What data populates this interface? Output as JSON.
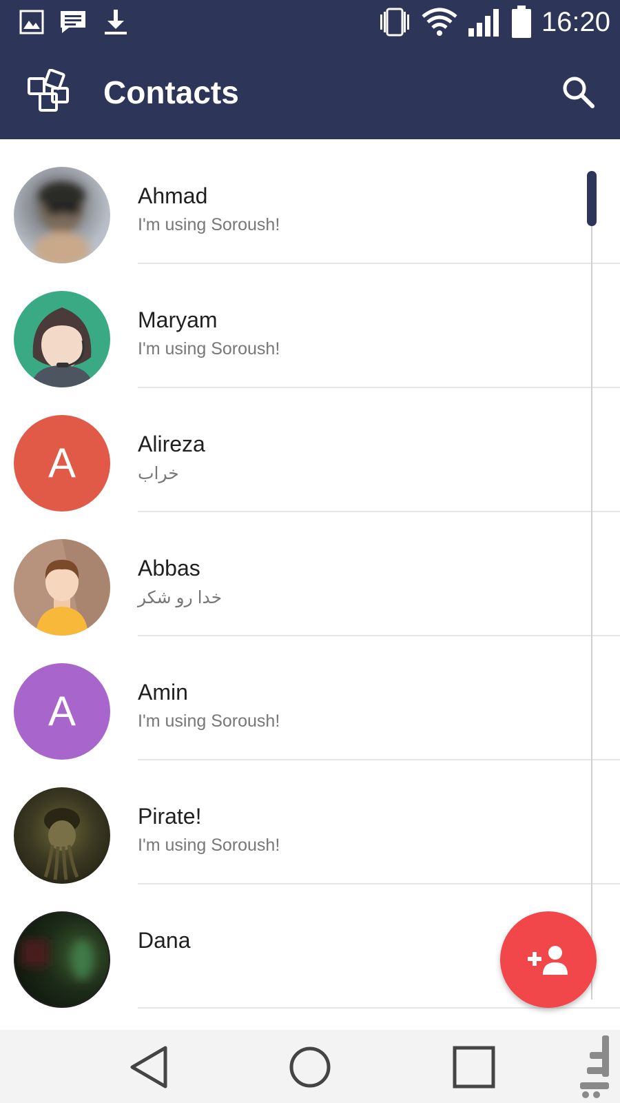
{
  "status_bar": {
    "time": "16:20",
    "left_icons": [
      "image-icon",
      "message-icon",
      "download-icon"
    ],
    "right_icons": [
      "vibrate-icon",
      "wifi-icon",
      "signal-icon",
      "battery-icon"
    ]
  },
  "app_bar": {
    "title": "Contacts",
    "logo_icon": "app-logo-icon",
    "search_icon": "search-icon"
  },
  "contacts": [
    {
      "name": "Ahmad",
      "status": "I'm using Soroush!",
      "avatar": "photo",
      "avatar_color": "#8a8f9a"
    },
    {
      "name": "Maryam",
      "status": "I'm using Soroush!",
      "avatar": "woman-illustration",
      "avatar_color": "#3aaa84"
    },
    {
      "name": "Alireza",
      "status": "خراب",
      "avatar": "letter",
      "avatar_letter": "A",
      "avatar_color": "#e05a47"
    },
    {
      "name": "Abbas",
      "status": "خدا رو شکر",
      "avatar": "man-illustration",
      "avatar_color": "#b7927c"
    },
    {
      "name": "Amin",
      "status": "I'm using Soroush!",
      "avatar": "letter",
      "avatar_letter": "A",
      "avatar_color": "#a865cc"
    },
    {
      "name": "Pirate!",
      "status": "I'm using Soroush!",
      "avatar": "photo-dark",
      "avatar_color": "#3c3a22"
    },
    {
      "name": "Dana",
      "status": "",
      "avatar": "photo-dark",
      "avatar_color": "#1c2a18"
    }
  ],
  "fab": {
    "icon": "add-contact-icon",
    "color": "#f2474a"
  },
  "nav_bar": {
    "buttons": [
      "back-icon",
      "home-icon",
      "recents-icon"
    ]
  },
  "colors": {
    "primary": "#2d3658",
    "accent": "#f2474a"
  }
}
